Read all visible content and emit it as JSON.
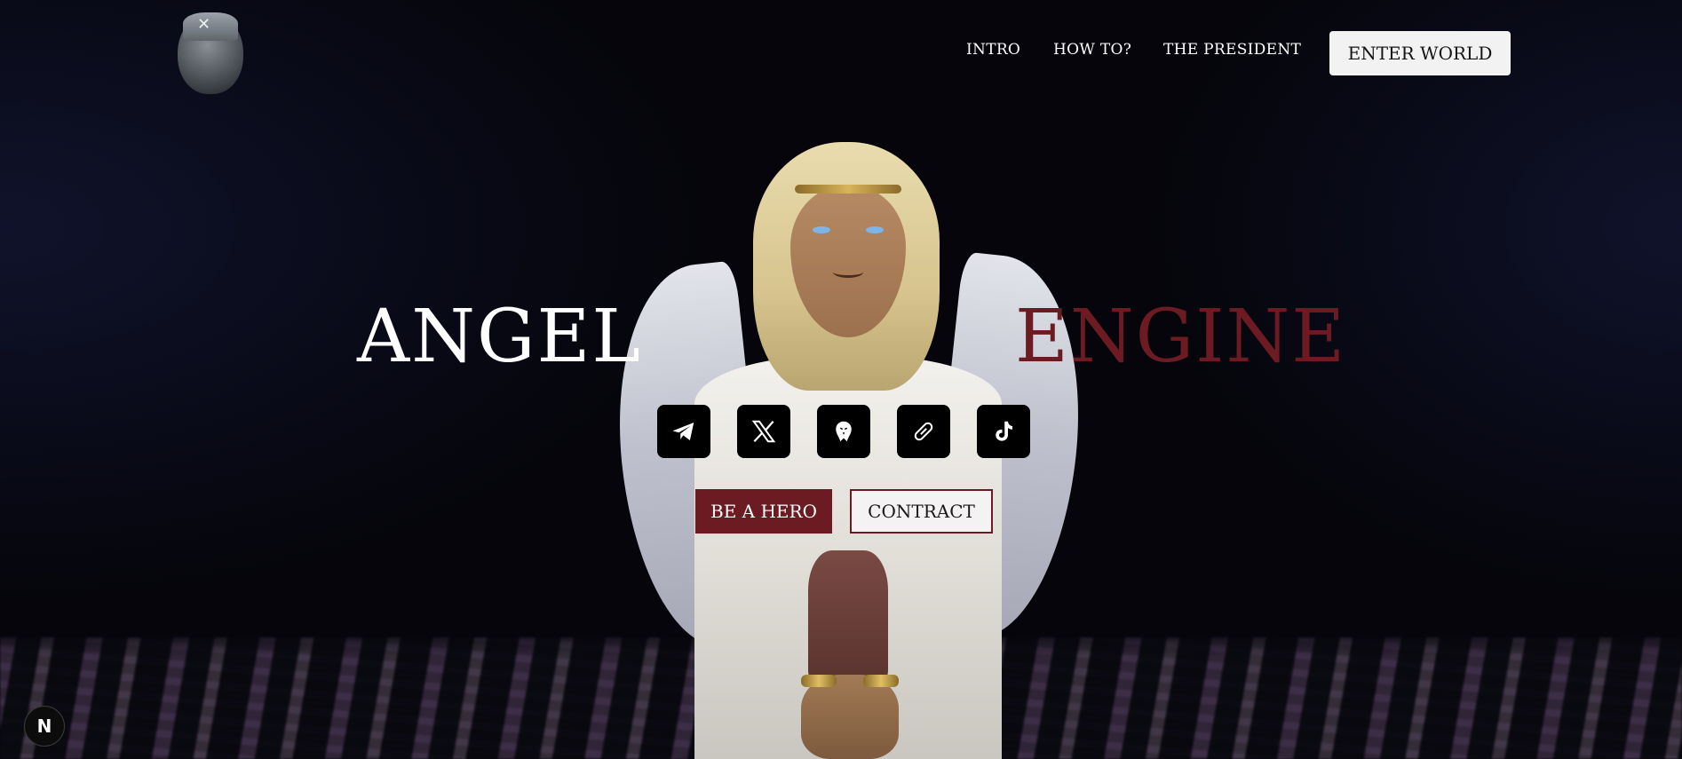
{
  "header": {
    "logo_icon": "masked-figure-logo-icon",
    "nav": [
      {
        "label": "INTRO"
      },
      {
        "label": "HOW TO?"
      },
      {
        "label": "THE PRESIDENT"
      }
    ],
    "enter_button": "ENTER WORLD"
  },
  "hero": {
    "title_left": "ANGEL",
    "title_right": "ENGINE",
    "title_right_color": "#6b1b21",
    "socials": [
      {
        "icon": "telegram-icon"
      },
      {
        "icon": "x-icon"
      },
      {
        "icon": "eagle-icon"
      },
      {
        "icon": "link-icon"
      },
      {
        "icon": "tiktok-icon"
      }
    ],
    "primary_button": "BE A HERO",
    "secondary_button": "CONTRACT",
    "accent_color": "#6b1b21"
  },
  "badge": {
    "letter": "N"
  }
}
